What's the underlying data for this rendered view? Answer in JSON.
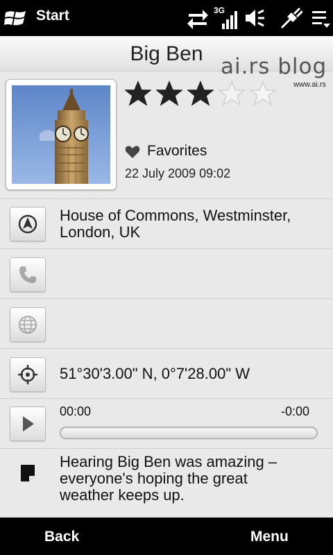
{
  "status_bar": {
    "start_label": "Start",
    "icons": [
      "windows-icon",
      "data-transfer-icon",
      "3g-signal-icon",
      "speaker-muted-icon",
      "usb-connection-icon",
      "menu-lines-icon"
    ],
    "network_label": "3G"
  },
  "title": "Big Ben",
  "watermark": {
    "text": "ai.rs blog",
    "url": "www.ai.rs"
  },
  "rating": {
    "value": 3,
    "max": 5
  },
  "favorites": {
    "label": "Favorites",
    "icon": "heart-icon"
  },
  "date": "22 July 2009 09:02",
  "address": {
    "line1": "House of Commons, Westminster,",
    "line2": "London, UK",
    "icon": "navigation-compass-icon"
  },
  "phone": {
    "icon": "phone-icon",
    "enabled": false
  },
  "web": {
    "icon": "globe-icon",
    "enabled": false
  },
  "coordinates": {
    "text": "51°30'3.00\" N, 0°7'28.00\" W",
    "icon": "crosshair-icon"
  },
  "audio": {
    "elapsed": "00:00",
    "remaining": "-0:00",
    "progress": 0,
    "icon": "play-icon"
  },
  "note": {
    "line1": "Hearing Big Ben was amazing –",
    "line2": "everyone's hoping the great",
    "line3": "weather keeps up.",
    "icon": "note-icon"
  },
  "softkeys": {
    "left": "Back",
    "right": "Menu"
  },
  "colors": {
    "accent": "#6a9fd8",
    "bar": "#000000",
    "background": "#e9e9e9"
  }
}
